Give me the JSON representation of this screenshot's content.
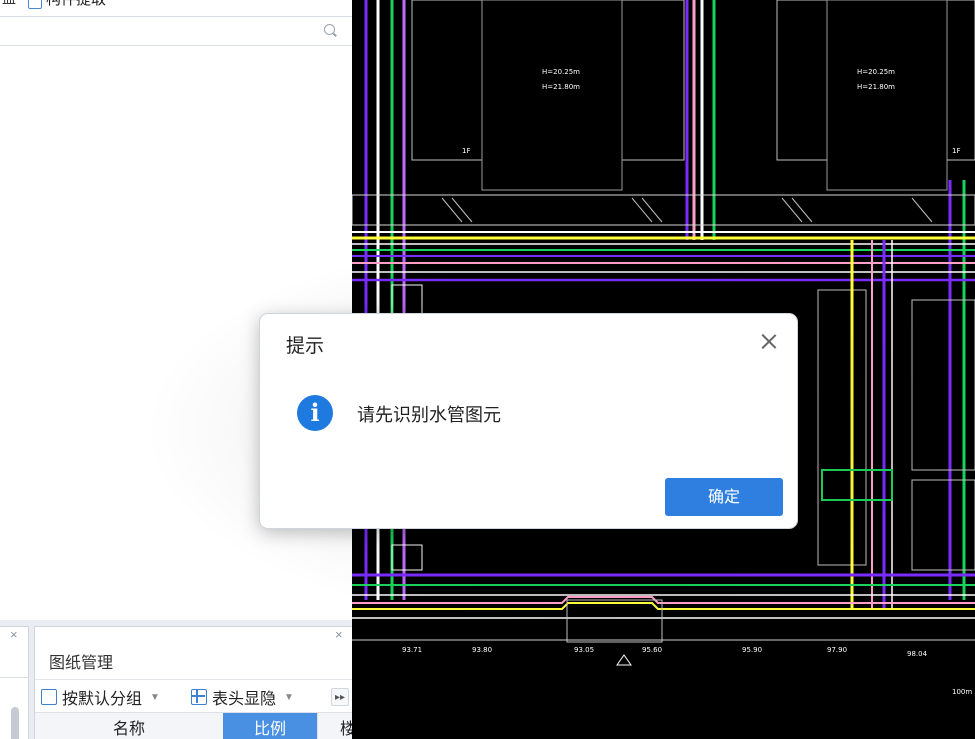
{
  "left_panel": {
    "header_prefix": "盖",
    "header_title": "构件提取",
    "search": {
      "placeholder": "",
      "value": ""
    }
  },
  "bottom_panels": {
    "left": {
      "close_label": "×"
    },
    "drawing_manager": {
      "title": "图纸管理",
      "close_label": "×",
      "toolbar": {
        "group_by_default": "按默认分组",
        "toggle_headers": "表头显隐",
        "more_label": "▸▸"
      },
      "columns": [
        "名称",
        "比例",
        "楼"
      ],
      "active_column": "比例"
    }
  },
  "dialog": {
    "title": "提示",
    "info_glyph": "i",
    "message": "请先识别水管图元",
    "ok_label": "确定",
    "close_label": "×"
  },
  "cad_labels": [
    "1F",
    "1F",
    "H=20.25m",
    "H=21.80m",
    "H=20.25m",
    "H=21.80m",
    "93.71",
    "93.80",
    "93.05",
    "95.60",
    "95.90",
    "97.90",
    "98.04",
    "100m"
  ],
  "colors": {
    "accent": "#2f7fe0",
    "info_icon": "#1f7ae0",
    "active_column_bg": "#4a90e2",
    "cad_background": "#000000"
  }
}
